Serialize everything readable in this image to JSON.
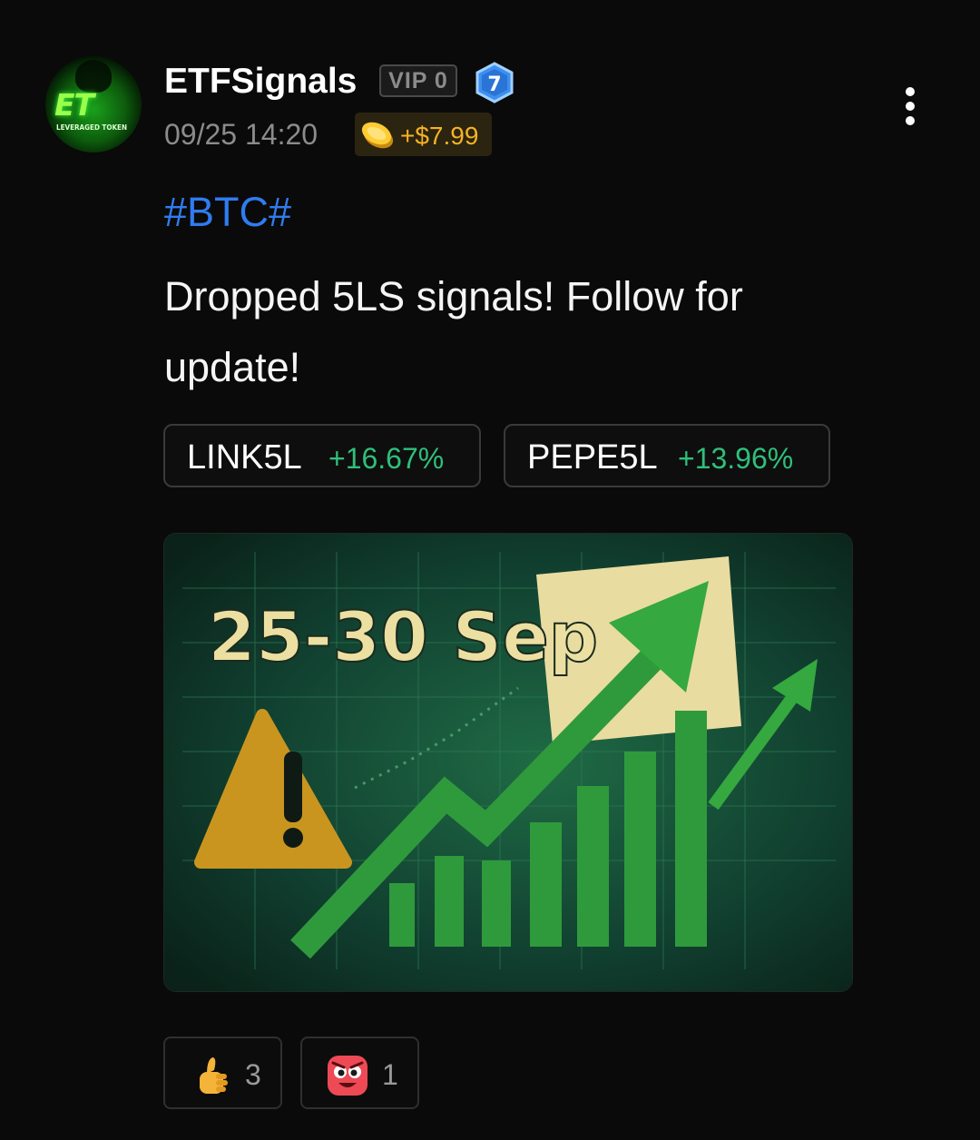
{
  "post": {
    "author": {
      "name": "ETFSignals",
      "avatar_monogram": "ET",
      "avatar_tagline": "LEVERAGED TOKEN",
      "vip_label": "VIP 0",
      "level": "7"
    },
    "timestamp": "09/25 14:20",
    "reward": {
      "icon": "coin-icon",
      "amount": "+$7.99"
    },
    "hashtag": "#BTC#",
    "body": "Dropped 5LS signals! Follow for update!",
    "tokens": [
      {
        "symbol": "LINK5L",
        "change": "+16.67%"
      },
      {
        "symbol": "PEPE5L",
        "change": "+13.96%"
      }
    ],
    "image": {
      "caption": "25-30 Sep"
    },
    "reactions": [
      {
        "icon": "thumbs-up-icon",
        "count": "3"
      },
      {
        "icon": "angry-face-icon",
        "count": "1"
      }
    ]
  },
  "colors": {
    "background": "#0a0a0a",
    "hashtag": "#2f7cf0",
    "gain": "#2fbf7a",
    "reward": "#f5b324",
    "level_badge": "#3d8ff0"
  }
}
